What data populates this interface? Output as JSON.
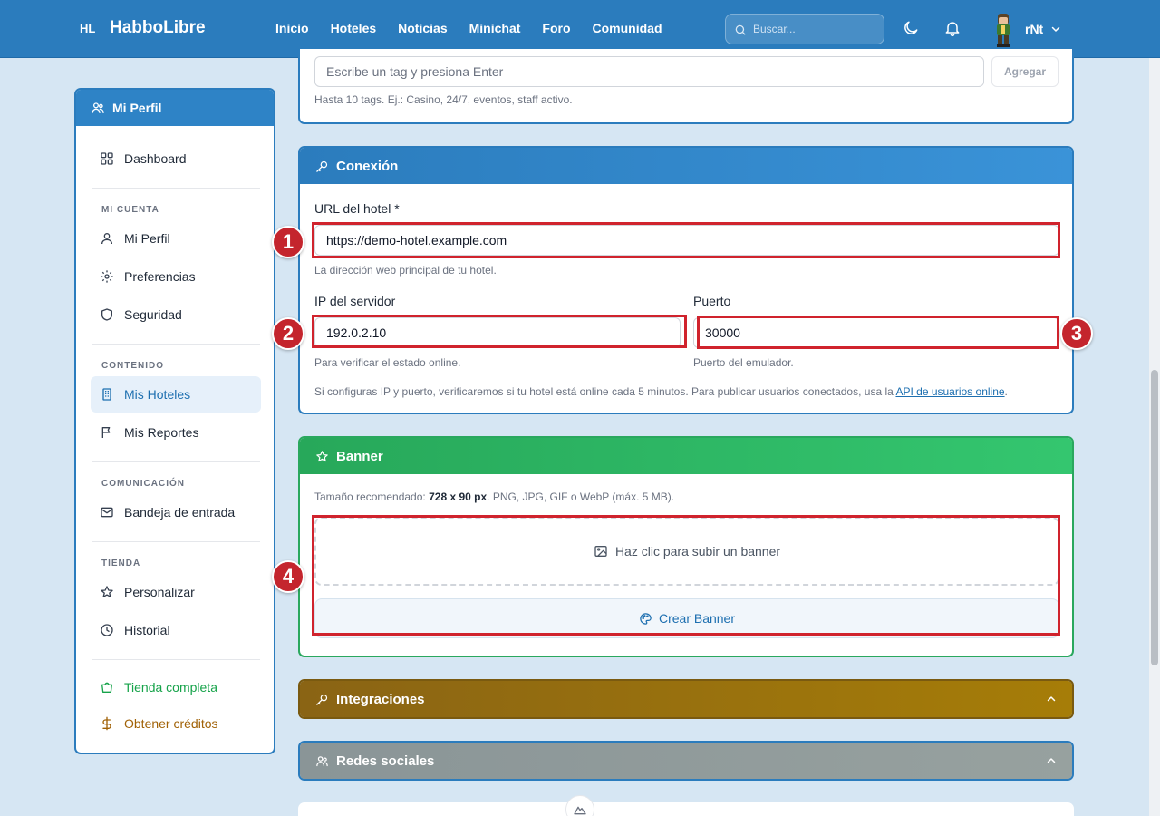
{
  "app": {
    "logo_short": "HL",
    "name": "HabboLibre"
  },
  "nav": {
    "links": [
      "Inicio",
      "Hoteles",
      "Noticias",
      "Minichat",
      "Foro",
      "Comunidad"
    ]
  },
  "search": {
    "placeholder": "Buscar..."
  },
  "user": {
    "name": "rNt"
  },
  "sidebar": {
    "title": "Mi Perfil",
    "dashboard": "Dashboard",
    "sections": {
      "cuenta": "MI CUENTA",
      "contenido": "CONTENIDO",
      "comunicacion": "COMUNICACIÓN",
      "tienda": "TIENDA"
    },
    "items": {
      "mi_perfil": "Mi Perfil",
      "preferencias": "Preferencias",
      "seguridad": "Seguridad",
      "mis_hoteles": "Mis Hoteles",
      "mis_reportes": "Mis Reportes",
      "bandeja": "Bandeja de entrada",
      "personalizar": "Personalizar",
      "historial": "Historial",
      "tienda_completa": "Tienda completa",
      "obtener_creditos": "Obtener créditos"
    },
    "active_item": "Mis Hoteles"
  },
  "tags": {
    "placeholder": "Escribe un tag y presiona Enter",
    "add_button": "Agregar",
    "help": "Hasta 10 tags. Ej.: Casino, 24/7, eventos, staff activo."
  },
  "connection": {
    "title": "Conexión",
    "url_label": "URL del hotel *",
    "url_value": "https://demo-hotel.example.com",
    "url_help": "La dirección web principal de tu hotel.",
    "ip_label": "IP del servidor",
    "ip_value": "192.0.2.10",
    "ip_help": "Para verificar el estado online.",
    "port_label": "Puerto",
    "port_value": "30000",
    "port_help": "Puerto del emulador.",
    "note": "Si configuras IP y puerto, verificaremos si tu hotel está online cada 5 minutos. Para publicar usuarios conectados, usa la",
    "note_link": "API de usuarios online",
    "note_end": "."
  },
  "banner": {
    "title": "Banner",
    "size_prefix": "Tamaño recomendado:",
    "size_value": "728 x 90 px",
    "size_suffix": ". PNG, JPG, GIF o WebP (máx. 5 MB).",
    "upload_label": "Haz clic para subir un banner",
    "create_button": "Crear Banner"
  },
  "integrations": {
    "title": "Integraciones"
  },
  "social": {
    "title": "Redes sociales"
  },
  "annotations": [
    "1",
    "2",
    "3",
    "4"
  ],
  "colors": {
    "header_blue": "#2b7cbd",
    "banner_green": "#2ebd67",
    "integrations_gold": "#9a7410",
    "social_gray": "#8f9a9c",
    "highlight_red": "#d0232d",
    "link_blue": "#1d6fb0"
  }
}
